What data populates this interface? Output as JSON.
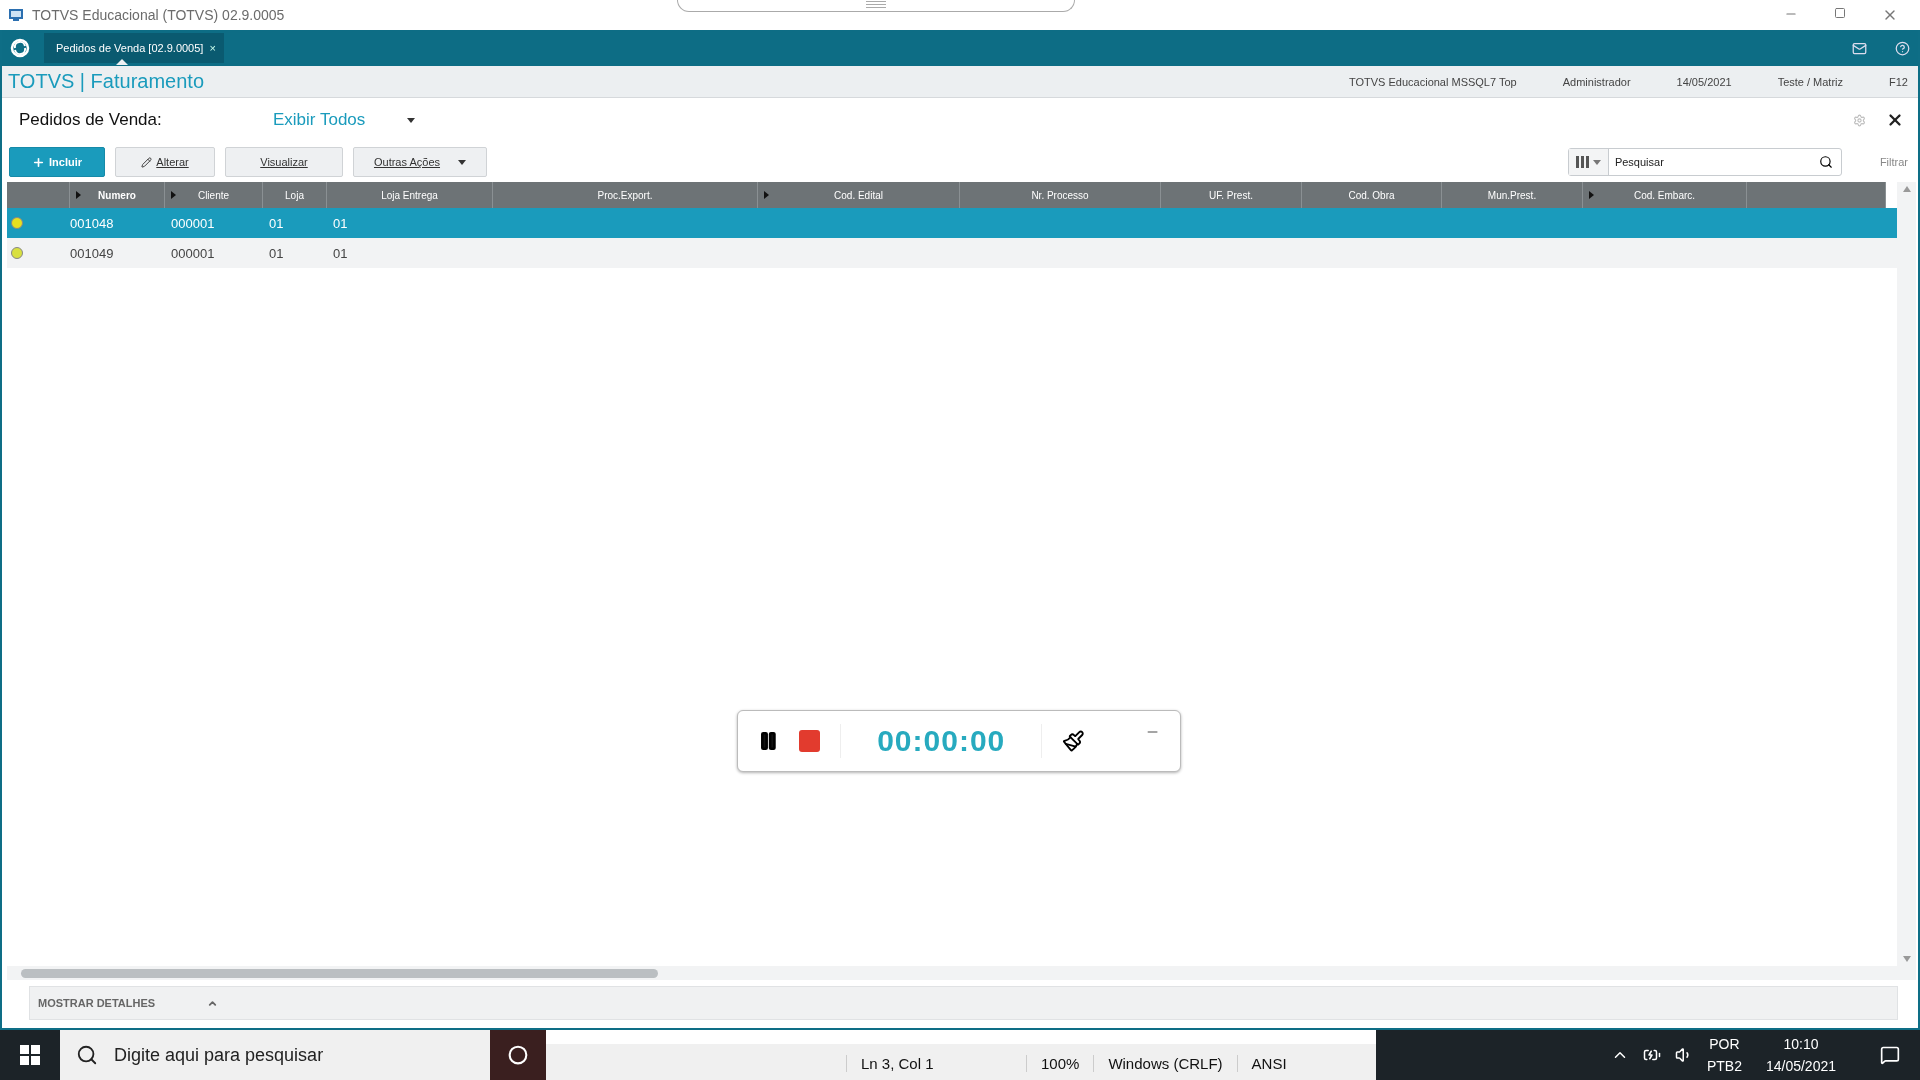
{
  "window": {
    "title": "TOTVS Educacional (TOTVS) 02.9.0005"
  },
  "tabs": [
    {
      "label": "Pedidos de Venda [02.9.0005]",
      "close": "×",
      "selected": true
    }
  ],
  "header": {
    "title": "TOTVS | Faturamento",
    "info": [
      "TOTVS Educacional MSSQL7 Top",
      "Administrador",
      "14/05/2021",
      "Teste / Matriz",
      "F12"
    ]
  },
  "browse": {
    "title": "Pedidos de Venda:",
    "filter": "Exibir Todos"
  },
  "toolbar": [
    {
      "label": "Incluir",
      "kind": "primary"
    },
    {
      "label": "Alterar",
      "kind": "edit"
    },
    {
      "label": "Visualizar",
      "kind": "plain"
    },
    {
      "label": "Outras Ações",
      "kind": "menu"
    }
  ],
  "search": {
    "placeholder": "Pesquisar",
    "filter_label": "Filtrar"
  },
  "table": {
    "columns": [
      {
        "arrow": false
      },
      {
        "label": "Numero",
        "arrow": true
      },
      {
        "label": "Cliente",
        "arrow": true
      },
      {
        "label": "Loja",
        "arrow": false
      },
      {
        "label": "Loja Entrega",
        "arrow": false
      },
      {
        "label": "Proc.Export.",
        "arrow": false
      },
      {
        "label": "Cod. Edital",
        "arrow": true
      },
      {
        "label": "Nr. Processo",
        "arrow": false
      },
      {
        "label": "UF. Prest.",
        "arrow": false
      },
      {
        "label": "Cod. Obra",
        "arrow": false
      },
      {
        "label": "Mun.Prest.",
        "arrow": false
      },
      {
        "label": "Cod. Embarc.",
        "arrow": true
      },
      {
        "arrow": false
      }
    ],
    "rows": [
      {
        "color": "#e8e020",
        "selected": true,
        "cells": [
          "001048",
          "000001",
          "01",
          "01"
        ]
      },
      {
        "color": "#d8e040",
        "selected": false,
        "cells": [
          "001049",
          "000001",
          "01",
          "01"
        ]
      }
    ]
  },
  "details": {
    "label": "MOSTRAR DETALHES"
  },
  "recorder": {
    "time": "00:00:00"
  },
  "taskbar": {
    "search_placeholder": "Digite aqui para pesquisar",
    "notepad_status": [
      "Ln 3, Col 1",
      "100%",
      "Windows (CRLF)",
      "ANSI"
    ],
    "language": [
      "POR",
      "PTB2"
    ],
    "time": "10:10",
    "date": "14/05/2021"
  }
}
